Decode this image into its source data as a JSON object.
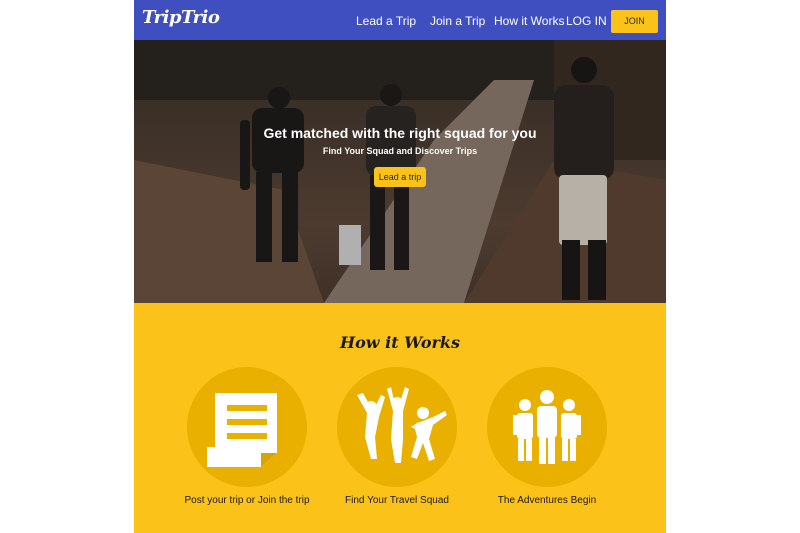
{
  "nav": {
    "logo": "TripTrio",
    "links": [
      "Lead a Trip",
      "Join a Trip",
      "How it Works",
      "LOG IN"
    ],
    "join_label": "JOIN",
    "colors": {
      "background": "#3f4fc0",
      "accent": "#fbc21a"
    }
  },
  "hero": {
    "title": "Get matched with the right squad for you",
    "subtitle": "Find Your Squad and Discover Trips",
    "button_label": "Lead a trip"
  },
  "how": {
    "title": "How it Works",
    "background": "#fbc21a",
    "steps": [
      {
        "label": "Post your trip or Join the trip",
        "icon": "document-post-icon"
      },
      {
        "label": "Find Your Travel Squad",
        "icon": "cheering-people-icon"
      },
      {
        "label": "The Adventures Begin",
        "icon": "hiker-group-icon"
      }
    ]
  }
}
